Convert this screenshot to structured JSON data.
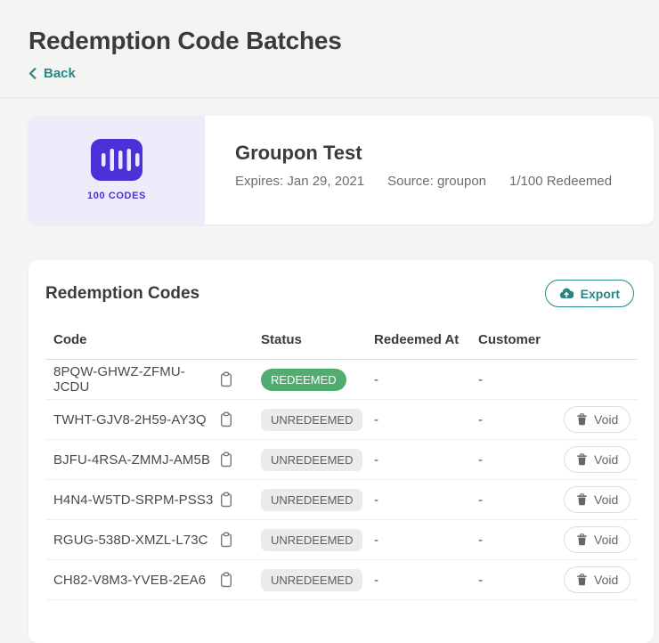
{
  "page": {
    "title": "Redemption Code Batches",
    "back_label": "Back"
  },
  "batch": {
    "codes_count": "100 CODES",
    "name": "Groupon Test",
    "expires": "Expires: Jan 29, 2021",
    "source": "Source: groupon",
    "redeemed": "1/100 Redeemed"
  },
  "codes_card": {
    "title": "Redemption Codes",
    "export_label": "Export",
    "void_button_label": "Void",
    "table": {
      "headers": [
        "Code",
        "Status",
        "Redeemed At",
        "Customer"
      ],
      "rows": [
        {
          "code": "8PQW-GHWZ-ZFMU-JCDU",
          "status": "REDEEMED",
          "redeemed_at": "-",
          "customer": "-",
          "voidable": false
        },
        {
          "code": "TWHT-GJV8-2H59-AY3Q",
          "status": "UNREDEEMED",
          "redeemed_at": "-",
          "customer": "-",
          "voidable": true
        },
        {
          "code": "BJFU-4RSA-ZMMJ-AM5B",
          "status": "UNREDEEMED",
          "redeemed_at": "-",
          "customer": "-",
          "voidable": true
        },
        {
          "code": "H4N4-W5TD-SRPM-PSS3",
          "status": "UNREDEEMED",
          "redeemed_at": "-",
          "customer": "-",
          "voidable": true
        },
        {
          "code": "RGUG-538D-XMZL-L73C",
          "status": "UNREDEEMED",
          "redeemed_at": "-",
          "customer": "-",
          "voidable": true
        },
        {
          "code": "CH82-V8M3-YVEB-2EA6",
          "status": "UNREDEEMED",
          "redeemed_at": "-",
          "customer": "-",
          "voidable": true
        }
      ]
    }
  },
  "icons": {
    "back": "chevron-left-icon",
    "batch": "barcode-icon",
    "export": "cloud-upload-icon",
    "copy": "clipboard-icon",
    "void": "trash-icon"
  },
  "colors": {
    "accent_teal": "#278786",
    "accent_purple": "#4C30D8",
    "purple_panel_bg": "#EDECFB",
    "redeemed_badge_bg": "#4FAE6F",
    "unredeemed_badge_bg": "#EBEBEA",
    "page_bg": "#F4F4F3",
    "card_bg": "#FFFFFF"
  }
}
